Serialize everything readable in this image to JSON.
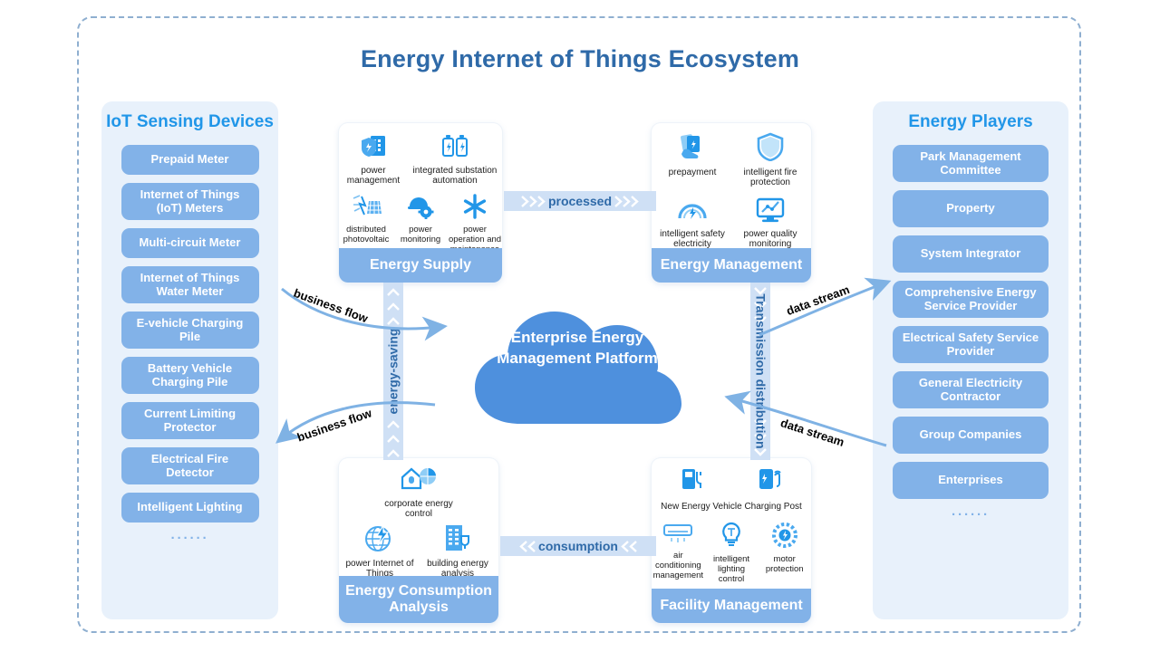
{
  "title": "Energy Internet of Things Ecosystem",
  "colors": {
    "title_blue": "#2f6aa8",
    "heading_blue": "#2196e8",
    "pill_blue": "#82b2e8",
    "panel_bg": "#e8f1fb",
    "band_blue": "#cfe0f5",
    "frame_dash": "#8fafd0"
  },
  "left_column": {
    "heading": "IoT Sensing Devices",
    "items": [
      "Prepaid Meter",
      "Internet of Things (IoT) Meters",
      "Multi-circuit Meter",
      "Internet of Things Water Meter",
      "E-vehicle Charging Pile",
      "Battery Vehicle Charging Pile",
      "Current Limiting Protector",
      "Electrical Fire Detector",
      "Intelligent Lighting"
    ],
    "more": "······"
  },
  "right_column": {
    "heading": "Energy Players",
    "items": [
      "Park Management Committee",
      "Property",
      "System Integrator",
      "Comprehensive Energy Service Provider",
      "Electrical Safety Service Provider",
      "General Electricity Contractor",
      "Group Companies",
      "Enterprises"
    ],
    "more": "······"
  },
  "center": {
    "cloud_label": "Enterprise Energy Management Platform"
  },
  "cards": {
    "energy_supply": {
      "label": "Energy Supply",
      "items": [
        {
          "icon": "building-shield-icon",
          "caption": "power management"
        },
        {
          "icon": "battery-pair-icon",
          "caption": "integrated substation automation"
        },
        {
          "icon": "solar-panel-icon",
          "caption": "distributed photovoltaic"
        },
        {
          "icon": "helmet-gear-icon",
          "caption": "power monitoring"
        },
        {
          "icon": "asterisk-star-icon",
          "caption": "power operation and maintenance"
        }
      ]
    },
    "energy_management": {
      "label": "Energy Management",
      "items": [
        {
          "icon": "card-hand-icon",
          "caption": "prepayment"
        },
        {
          "icon": "shield-icon",
          "caption": "intelligent fire protection"
        },
        {
          "icon": "gauge-icon",
          "caption": "intelligent safety electricity"
        },
        {
          "icon": "monitor-chart-icon",
          "caption": "power quality monitoring"
        }
      ]
    },
    "energy_consumption": {
      "label": "Energy Consumption Analysis",
      "items": [
        {
          "icon": "house-pie-icon",
          "caption": "corporate energy control"
        },
        {
          "icon": "globe-bolt-icon",
          "caption": "power Internet of Things"
        },
        {
          "icon": "building-plug-icon",
          "caption": "building energy analysis"
        }
      ]
    },
    "facility_management": {
      "label": "Facility Management",
      "items": [
        {
          "icon": "charging-post-icon",
          "caption": ""
        },
        {
          "icon": "charging-pump-icon",
          "caption": ""
        },
        {
          "icon": "",
          "caption": "New Energy Vehicle Charging Post"
        },
        {
          "icon": "air-conditioner-icon",
          "caption": "air conditioning management"
        },
        {
          "icon": "bulb-icon",
          "caption": "intelligent lighting control"
        },
        {
          "icon": "motor-gear-icon",
          "caption": "motor protection"
        }
      ],
      "group_caption": "New Energy Vehicle Charging Post"
    }
  },
  "flows": {
    "top_band": "processed",
    "bottom_band": "consumption",
    "left_vertical": "energy-saving",
    "right_vertical": "Transmission distribution",
    "business_flow_top": "business flow",
    "business_flow_bottom": "business flow",
    "data_stream_top": "data stream",
    "data_stream_bottom": "data stream"
  }
}
